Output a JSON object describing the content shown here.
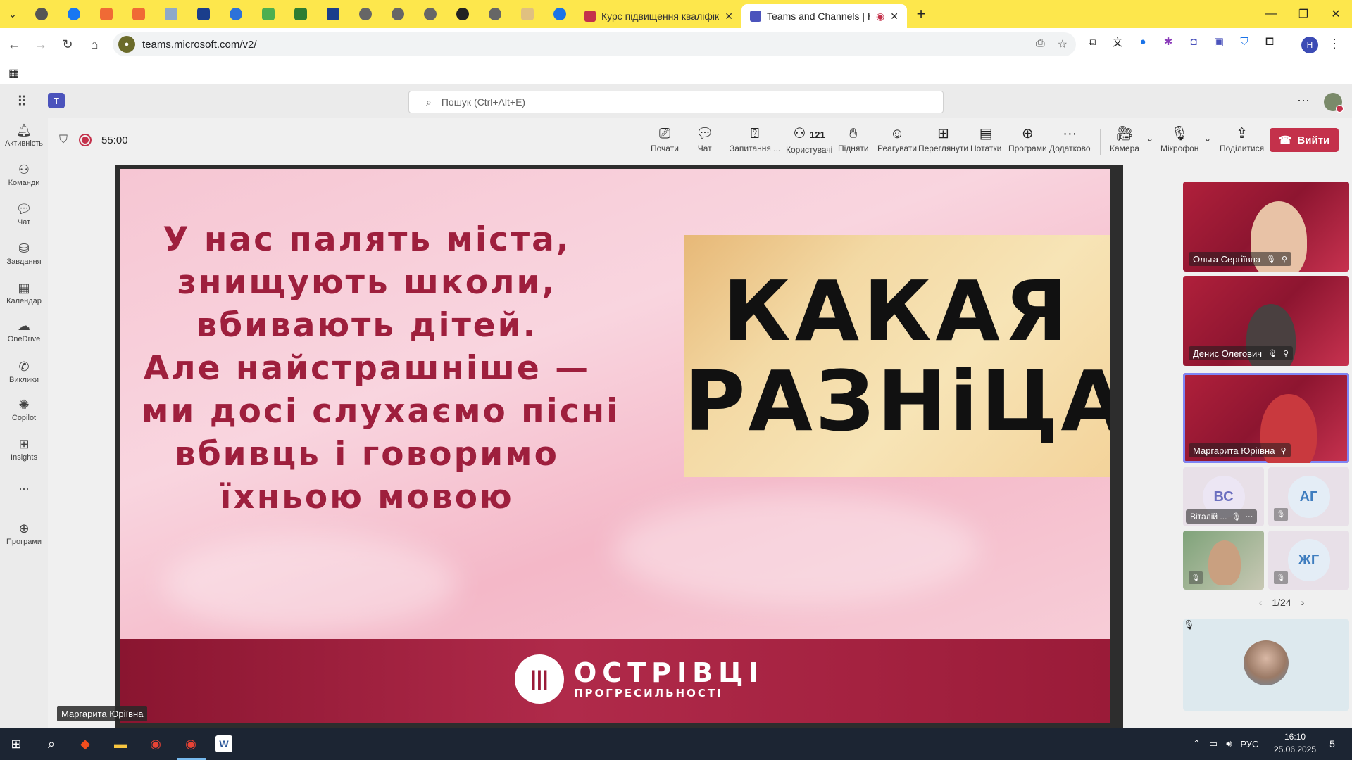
{
  "browser": {
    "tabs": [
      {
        "title": "Курс підвищення кваліфікаці",
        "active": false,
        "favicon_color": "#c4314b"
      },
      {
        "title": "Teams and Channels | Курс",
        "active": true,
        "favicon_color": "#4b53bc"
      }
    ],
    "url": "teams.microsoft.com/v2/",
    "profile_initial": "H"
  },
  "teams": {
    "search_placeholder": "Пошук (Ctrl+Alt+E)",
    "rail": [
      {
        "label": "Активність",
        "icon": "bell-icon"
      },
      {
        "label": "Команди",
        "icon": "teams-icon"
      },
      {
        "label": "Чат",
        "icon": "chat-icon"
      },
      {
        "label": "Завдання",
        "icon": "assignments-icon"
      },
      {
        "label": "Календар",
        "icon": "calendar-icon"
      },
      {
        "label": "OneDrive",
        "icon": "cloud-icon"
      },
      {
        "label": "Виклики",
        "icon": "phone-icon"
      },
      {
        "label": "Copilot",
        "icon": "copilot-icon"
      },
      {
        "label": "Insights",
        "icon": "insights-icon"
      },
      {
        "label": "...",
        "icon": "more-icon"
      },
      {
        "label": "Програми",
        "icon": "apps-icon"
      }
    ]
  },
  "meeting": {
    "timer": "55:00",
    "controls": [
      {
        "label": "Почати",
        "icon": "share-screen-icon"
      },
      {
        "label": "Чат",
        "icon": "chat-icon"
      },
      {
        "label": "Запитання ...",
        "icon": "qa-icon"
      },
      {
        "label": "Користувачі",
        "icon": "people-icon",
        "count": "121"
      },
      {
        "label": "Підняти",
        "icon": "raise-hand-icon"
      },
      {
        "label": "Реагувати",
        "icon": "react-icon"
      },
      {
        "label": "Переглянути",
        "icon": "view-icon"
      },
      {
        "label": "Нотатки",
        "icon": "notes-icon"
      },
      {
        "label": "Програми",
        "icon": "add-app-icon"
      },
      {
        "label": "Додатково",
        "icon": "more-icon"
      },
      {
        "label": "Камера",
        "icon": "camera-off-icon"
      },
      {
        "label": "Мікрофон",
        "icon": "mic-off-icon"
      },
      {
        "label": "Поділитися",
        "icon": "share-icon"
      }
    ],
    "leave_label": "Вийти",
    "presenter_name": "Маргарита Юріївна",
    "page_indicator": "1/24"
  },
  "slide": {
    "left_lines": [
      "У нас палять міста,",
      "знищують школи,",
      "вбивають дітей.",
      "Але найстрашніше —",
      "ми досі слухаємо пісні",
      "вбивць  і говоримо",
      "їхньою мовою"
    ],
    "headline_line1": "КАКАЯ",
    "headline_line2_main": "РАЗНіЦА",
    "headline_line2_mark": "?",
    "logo_line1": "ОСТРІВЦІ",
    "logo_line2": "ПРОГРЕСИЛЬНОСТІ"
  },
  "participants": [
    {
      "name": "Ольга Сергіївна",
      "muted": true,
      "pinned": true,
      "type": "video"
    },
    {
      "name": "Денис Олегович",
      "muted": true,
      "pinned": true,
      "type": "video"
    },
    {
      "name": "Маргарита Юріївна",
      "muted": false,
      "pinned": true,
      "type": "video",
      "active": true
    },
    {
      "name": "Віталій ...",
      "initials": "ВС",
      "muted": true,
      "type": "avatar",
      "color": "#6b6fbf"
    },
    {
      "name": "",
      "initials": "АГ",
      "muted": true,
      "type": "avatar",
      "color": "#3f7dbf"
    },
    {
      "name": "",
      "muted": true,
      "type": "video-small"
    },
    {
      "name": "",
      "initials": "ЖГ",
      "muted": true,
      "type": "avatar",
      "color": "#3f7dbf"
    }
  ],
  "taskbar": {
    "language": "РУС",
    "time": "16:10",
    "date": "25.06.2025",
    "notifications": "5"
  }
}
